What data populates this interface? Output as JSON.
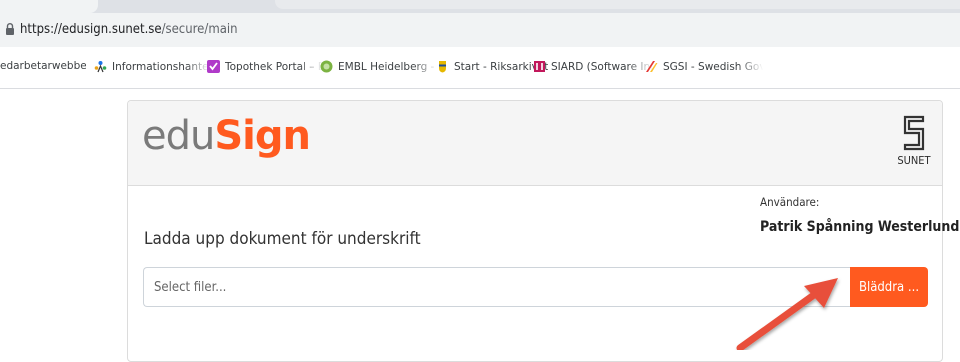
{
  "browser": {
    "url_host": "https://edusign.sunet.se",
    "url_path": "/secure/main",
    "bookmarks": [
      {
        "label": "edarbetarwebben p",
        "icon": "none"
      },
      {
        "label": "Informationshantering",
        "icon": "people-icon"
      },
      {
        "label": "Topothek Portal – Da",
        "icon": "topothek-icon"
      },
      {
        "label": "EMBL Heidelberg - Th",
        "icon": "embl-icon"
      },
      {
        "label": "Start - Riksarkivet",
        "icon": "riksarkivet-icon"
      },
      {
        "label": "SIARD (Software Inde",
        "icon": "siard-icon"
      },
      {
        "label": "SGSI - Swedish Gove",
        "icon": "sgsi-icon"
      }
    ]
  },
  "app": {
    "logo_edu": "edu",
    "logo_sign": "Sign",
    "partner_logo_label": "SUNET",
    "accent_color": "#ff5a1f"
  },
  "user": {
    "label": "Användare:",
    "name": "Patrik Spånning Westerlund"
  },
  "upload": {
    "heading": "Ladda upp dokument för underskrift",
    "placeholder": "Select filer...",
    "browse_label": "Bläddra ..."
  }
}
